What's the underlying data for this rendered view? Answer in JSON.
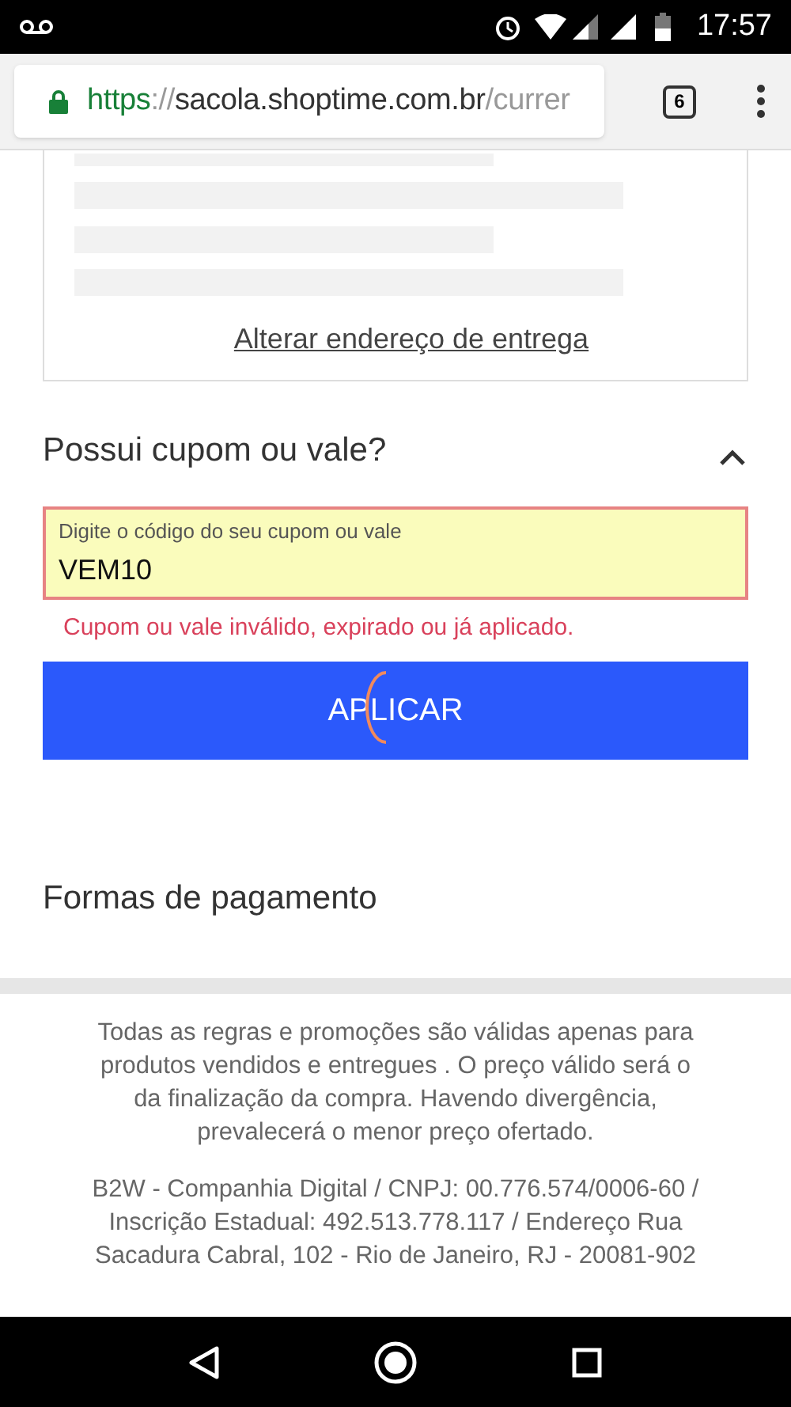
{
  "status_bar": {
    "time": "17:57"
  },
  "browser": {
    "url_scheme": "https",
    "url_separator": "://",
    "url_host": "sacola.shoptime.com.br",
    "url_path": "/currer",
    "tab_count": "6"
  },
  "address_card": {
    "link": "Alterar endereço de entrega"
  },
  "coupon": {
    "title": "Possui cupom ou vale?",
    "expanded": true,
    "field_label": "Digite o código do seu cupom ou vale",
    "value": "VEM10",
    "error": "Cupom ou vale inválido, expirado ou já aplicado.",
    "button": "APLICAR",
    "loading": true
  },
  "payment": {
    "title": "Formas de pagamento"
  },
  "footer": [
    "Todas as regras e promoções são válidas apenas para produtos vendidos e entregues . O preço válido será o da finalização da compra. Havendo divergência, prevalecerá o menor preço ofertado.",
    "B2W - Companhia Digital / CNPJ: 00.776.574/0006-60 / Inscrição Estadual: 492.513.778.117 / Endereço Rua Sacadura Cabral, 102 - Rio de Janeiro, RJ - 20081-902"
  ]
}
